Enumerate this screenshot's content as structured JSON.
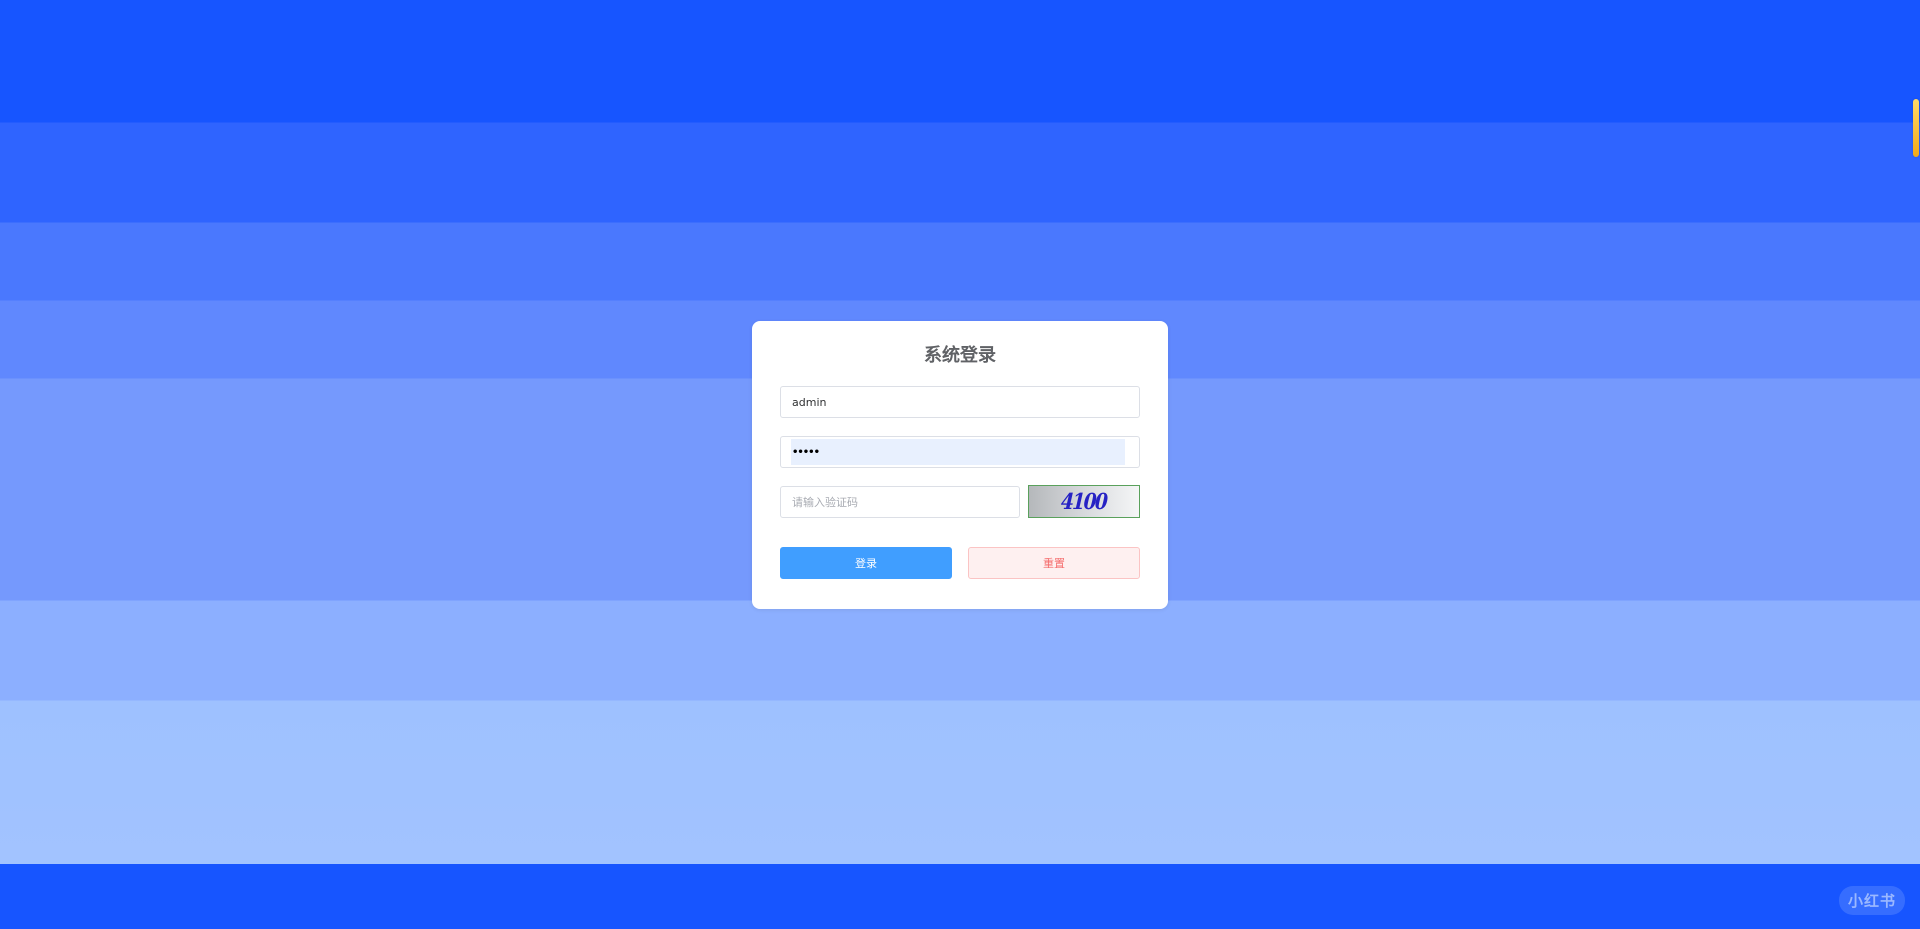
{
  "login": {
    "title": "系统登录",
    "username_value": "admin",
    "password_value": "•••••",
    "captcha_placeholder": "请输入验证码",
    "captcha_image_text": "4100",
    "login_label": "登录",
    "reset_label": "重置"
  },
  "watermark": {
    "text": "小红书"
  },
  "colors": {
    "background_top": "#1755ff",
    "background_bottom": "#a2c3ff",
    "primary_button": "#409eff",
    "reset_button_text": "#f56c6c",
    "captcha_text": "#2622c4"
  }
}
